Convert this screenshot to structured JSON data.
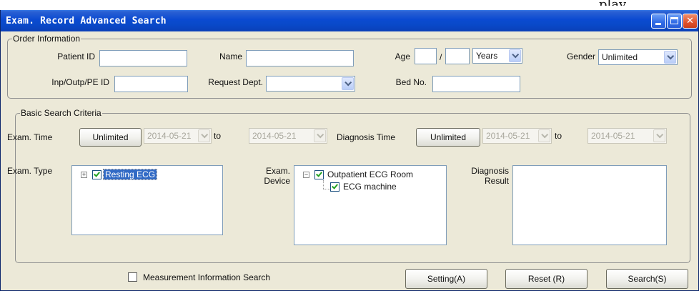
{
  "outside_text": "play",
  "window": {
    "title": "Exam. Record Advanced Search",
    "controls": {
      "minimize": "minimize-icon",
      "maximize": "maximize-icon",
      "close": "close-icon"
    }
  },
  "order_info": {
    "legend": "Order Information",
    "patient_id": {
      "label": "Patient ID",
      "value": ""
    },
    "name": {
      "label": "Name",
      "value": ""
    },
    "age": {
      "label": "Age",
      "value1": "",
      "separator": "/",
      "value2": "",
      "unit": "Years"
    },
    "gender": {
      "label": "Gender",
      "value": "Unlimited"
    },
    "inp_id": {
      "label": "Inp/Outp/PE ID",
      "value": ""
    },
    "request_dept": {
      "label": "Request Dept.",
      "value": ""
    },
    "bed_no": {
      "label": "Bed No.",
      "value": ""
    }
  },
  "basic_criteria": {
    "legend": "Basic Search Criteria",
    "exam_time": {
      "label": "Exam. Time",
      "button": "Unlimited",
      "from": "2014-05-21",
      "to_label": "to",
      "to": "2014-05-21"
    },
    "diagnosis_time": {
      "label": "Diagnosis Time",
      "button": "Unlimited",
      "from": "2014-05-21",
      "to_label": "to",
      "to": "2014-05-21"
    },
    "exam_type": {
      "label": "Exam. Type",
      "items": [
        {
          "label": "Resting ECG",
          "checked": true,
          "selected": true
        }
      ]
    },
    "exam_device": {
      "label_line1": "Exam.",
      "label_line2": "Device",
      "root": {
        "label": "Outpatient ECG Room",
        "checked": true
      },
      "child": {
        "label": "ECG machine",
        "checked": true
      }
    },
    "diagnosis_result": {
      "label_line1": "Diagnosis",
      "label_line2": "Result"
    }
  },
  "footer": {
    "measurement_search": {
      "label": "Measurement Information Search",
      "checked": false
    },
    "setting_button": "Setting(A)",
    "reset_button": "Reset (R)",
    "search_button": "Search(S)"
  }
}
